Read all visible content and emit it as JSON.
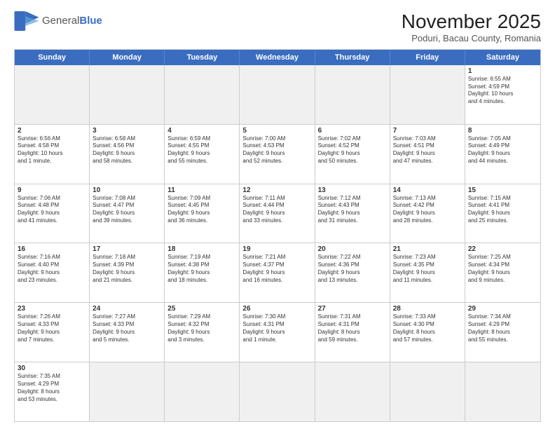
{
  "header": {
    "logo_general": "General",
    "logo_blue": "Blue",
    "month_title": "November 2025",
    "subtitle": "Poduri, Bacau County, Romania"
  },
  "days_of_week": [
    "Sunday",
    "Monday",
    "Tuesday",
    "Wednesday",
    "Thursday",
    "Friday",
    "Saturday"
  ],
  "weeks": [
    [
      {
        "day": "",
        "text": "",
        "empty": true
      },
      {
        "day": "",
        "text": "",
        "empty": true
      },
      {
        "day": "",
        "text": "",
        "empty": true
      },
      {
        "day": "",
        "text": "",
        "empty": true
      },
      {
        "day": "",
        "text": "",
        "empty": true
      },
      {
        "day": "",
        "text": "",
        "empty": true
      },
      {
        "day": "1",
        "text": "Sunrise: 6:55 AM\nSunset: 4:59 PM\nDaylight: 10 hours\nand 4 minutes.",
        "empty": false
      }
    ],
    [
      {
        "day": "2",
        "text": "Sunrise: 6:56 AM\nSunset: 4:58 PM\nDaylight: 10 hours\nand 1 minute.",
        "empty": false
      },
      {
        "day": "3",
        "text": "Sunrise: 6:58 AM\nSunset: 4:56 PM\nDaylight: 9 hours\nand 58 minutes.",
        "empty": false
      },
      {
        "day": "4",
        "text": "Sunrise: 6:59 AM\nSunset: 4:55 PM\nDaylight: 9 hours\nand 55 minutes.",
        "empty": false
      },
      {
        "day": "5",
        "text": "Sunrise: 7:00 AM\nSunset: 4:53 PM\nDaylight: 9 hours\nand 52 minutes.",
        "empty": false
      },
      {
        "day": "6",
        "text": "Sunrise: 7:02 AM\nSunset: 4:52 PM\nDaylight: 9 hours\nand 50 minutes.",
        "empty": false
      },
      {
        "day": "7",
        "text": "Sunrise: 7:03 AM\nSunset: 4:51 PM\nDaylight: 9 hours\nand 47 minutes.",
        "empty": false
      },
      {
        "day": "8",
        "text": "Sunrise: 7:05 AM\nSunset: 4:49 PM\nDaylight: 9 hours\nand 44 minutes.",
        "empty": false
      }
    ],
    [
      {
        "day": "9",
        "text": "Sunrise: 7:06 AM\nSunset: 4:48 PM\nDaylight: 9 hours\nand 41 minutes.",
        "empty": false
      },
      {
        "day": "10",
        "text": "Sunrise: 7:08 AM\nSunset: 4:47 PM\nDaylight: 9 hours\nand 39 minutes.",
        "empty": false
      },
      {
        "day": "11",
        "text": "Sunrise: 7:09 AM\nSunset: 4:45 PM\nDaylight: 9 hours\nand 36 minutes.",
        "empty": false
      },
      {
        "day": "12",
        "text": "Sunrise: 7:11 AM\nSunset: 4:44 PM\nDaylight: 9 hours\nand 33 minutes.",
        "empty": false
      },
      {
        "day": "13",
        "text": "Sunrise: 7:12 AM\nSunset: 4:43 PM\nDaylight: 9 hours\nand 31 minutes.",
        "empty": false
      },
      {
        "day": "14",
        "text": "Sunrise: 7:13 AM\nSunset: 4:42 PM\nDaylight: 9 hours\nand 28 minutes.",
        "empty": false
      },
      {
        "day": "15",
        "text": "Sunrise: 7:15 AM\nSunset: 4:41 PM\nDaylight: 9 hours\nand 25 minutes.",
        "empty": false
      }
    ],
    [
      {
        "day": "16",
        "text": "Sunrise: 7:16 AM\nSunset: 4:40 PM\nDaylight: 9 hours\nand 23 minutes.",
        "empty": false
      },
      {
        "day": "17",
        "text": "Sunrise: 7:18 AM\nSunset: 4:39 PM\nDaylight: 9 hours\nand 21 minutes.",
        "empty": false
      },
      {
        "day": "18",
        "text": "Sunrise: 7:19 AM\nSunset: 4:38 PM\nDaylight: 9 hours\nand 18 minutes.",
        "empty": false
      },
      {
        "day": "19",
        "text": "Sunrise: 7:21 AM\nSunset: 4:37 PM\nDaylight: 9 hours\nand 16 minutes.",
        "empty": false
      },
      {
        "day": "20",
        "text": "Sunrise: 7:22 AM\nSunset: 4:36 PM\nDaylight: 9 hours\nand 13 minutes.",
        "empty": false
      },
      {
        "day": "21",
        "text": "Sunrise: 7:23 AM\nSunset: 4:35 PM\nDaylight: 9 hours\nand 11 minutes.",
        "empty": false
      },
      {
        "day": "22",
        "text": "Sunrise: 7:25 AM\nSunset: 4:34 PM\nDaylight: 9 hours\nand 9 minutes.",
        "empty": false
      }
    ],
    [
      {
        "day": "23",
        "text": "Sunrise: 7:26 AM\nSunset: 4:33 PM\nDaylight: 9 hours\nand 7 minutes.",
        "empty": false
      },
      {
        "day": "24",
        "text": "Sunrise: 7:27 AM\nSunset: 4:33 PM\nDaylight: 9 hours\nand 5 minutes.",
        "empty": false
      },
      {
        "day": "25",
        "text": "Sunrise: 7:29 AM\nSunset: 4:32 PM\nDaylight: 9 hours\nand 3 minutes.",
        "empty": false
      },
      {
        "day": "26",
        "text": "Sunrise: 7:30 AM\nSunset: 4:31 PM\nDaylight: 9 hours\nand 1 minute.",
        "empty": false
      },
      {
        "day": "27",
        "text": "Sunrise: 7:31 AM\nSunset: 4:31 PM\nDaylight: 8 hours\nand 59 minutes.",
        "empty": false
      },
      {
        "day": "28",
        "text": "Sunrise: 7:33 AM\nSunset: 4:30 PM\nDaylight: 8 hours\nand 57 minutes.",
        "empty": false
      },
      {
        "day": "29",
        "text": "Sunrise: 7:34 AM\nSunset: 4:29 PM\nDaylight: 8 hours\nand 55 minutes.",
        "empty": false
      }
    ],
    [
      {
        "day": "30",
        "text": "Sunrise: 7:35 AM\nSunset: 4:29 PM\nDaylight: 8 hours\nand 53 minutes.",
        "empty": false
      },
      {
        "day": "",
        "text": "",
        "empty": true
      },
      {
        "day": "",
        "text": "",
        "empty": true
      },
      {
        "day": "",
        "text": "",
        "empty": true
      },
      {
        "day": "",
        "text": "",
        "empty": true
      },
      {
        "day": "",
        "text": "",
        "empty": true
      },
      {
        "day": "",
        "text": "",
        "empty": true
      }
    ]
  ]
}
